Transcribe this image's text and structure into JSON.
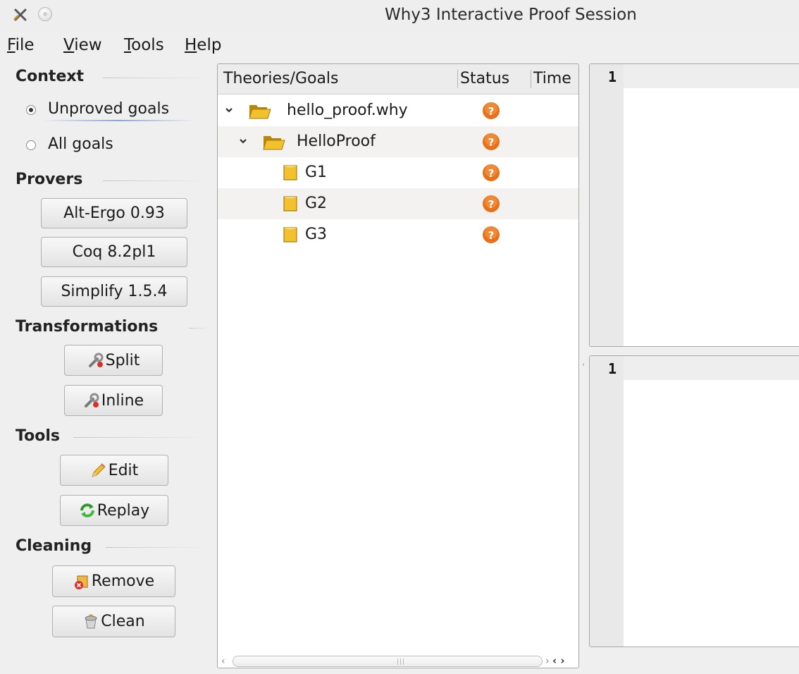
{
  "window": {
    "title": "Why3 Interactive Proof Session"
  },
  "menu": [
    {
      "mnemonic": "F",
      "rest": "ile"
    },
    {
      "mnemonic": "V",
      "rest": "iew"
    },
    {
      "mnemonic": "T",
      "rest": "ools"
    },
    {
      "mnemonic": "H",
      "rest": "elp"
    }
  ],
  "sidebar": {
    "context": {
      "title": "Context",
      "options": [
        {
          "label": "Unproved goals",
          "checked": true
        },
        {
          "label": "All goals",
          "checked": false
        }
      ]
    },
    "provers": {
      "title": "Provers",
      "buttons": [
        "Alt-Ergo 0.93",
        "Coq 8.2pl1",
        "Simplify 1.5.4"
      ]
    },
    "transformations": {
      "title": "Transformations",
      "buttons": [
        {
          "label": "Split",
          "icon": "wrench-icon"
        },
        {
          "label": "Inline",
          "icon": "wrench-icon"
        }
      ]
    },
    "tools": {
      "title": "Tools",
      "buttons": [
        {
          "label": "Edit",
          "icon": "pencil-icon"
        },
        {
          "label": "Replay",
          "icon": "replay-icon"
        }
      ]
    },
    "cleaning": {
      "title": "Cleaning",
      "buttons": [
        {
          "label": "Remove",
          "icon": "remove-icon"
        },
        {
          "label": "Clean",
          "icon": "clean-icon"
        }
      ]
    }
  },
  "tree": {
    "columns": [
      "Theories/Goals",
      "Status",
      "Time"
    ],
    "rows": [
      {
        "label": "hello_proof.why",
        "kind": "file",
        "expanded": true,
        "status": "unknown"
      },
      {
        "label": "HelloProof",
        "kind": "theory",
        "expanded": true,
        "status": "unknown"
      },
      {
        "label": "G1",
        "kind": "goal",
        "status": "unknown"
      },
      {
        "label": "G2",
        "kind": "goal",
        "status": "unknown"
      },
      {
        "label": "G3",
        "kind": "goal",
        "status": "unknown"
      }
    ]
  },
  "editors": {
    "top": {
      "line_number": "1"
    },
    "bottom": {
      "line_number": "1"
    }
  },
  "colors": {
    "status_unknown": "#e8701a",
    "folder": "#e4b418"
  }
}
